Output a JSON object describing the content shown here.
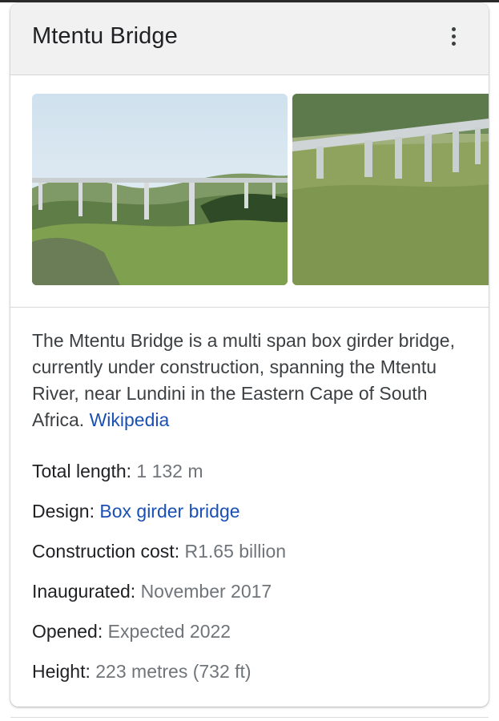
{
  "panel": {
    "title": "Mtentu Bridge",
    "more_icon": "more-vert-icon"
  },
  "images": [
    {
      "icon": "bridge-photo-wide"
    },
    {
      "icon": "bridge-photo-closeup"
    }
  ],
  "description": {
    "text": "The Mtentu Bridge is a multi span box girder bridge, currently under construction, spanning the Mtentu River, near Lundini in the Eastern Cape of South Africa.",
    "source_link": "Wikipedia"
  },
  "facts": [
    {
      "label": "Total length:",
      "value": "1 132 m",
      "is_link": false
    },
    {
      "label": "Design:",
      "value": "Box girder bridge",
      "is_link": true
    },
    {
      "label": "Construction cost:",
      "value": "R1.65 billion",
      "is_link": false
    },
    {
      "label": "Inaugurated:",
      "value": "November 2017",
      "is_link": false
    },
    {
      "label": "Opened:",
      "value": "Expected 2022",
      "is_link": false
    },
    {
      "label": "Height:",
      "value": "223 metres (732 ft)",
      "is_link": false
    }
  ],
  "colors": {
    "link": "#1a4fb3",
    "label": "#202124",
    "value": "#70757a",
    "header_bg": "#f1f1f1"
  }
}
